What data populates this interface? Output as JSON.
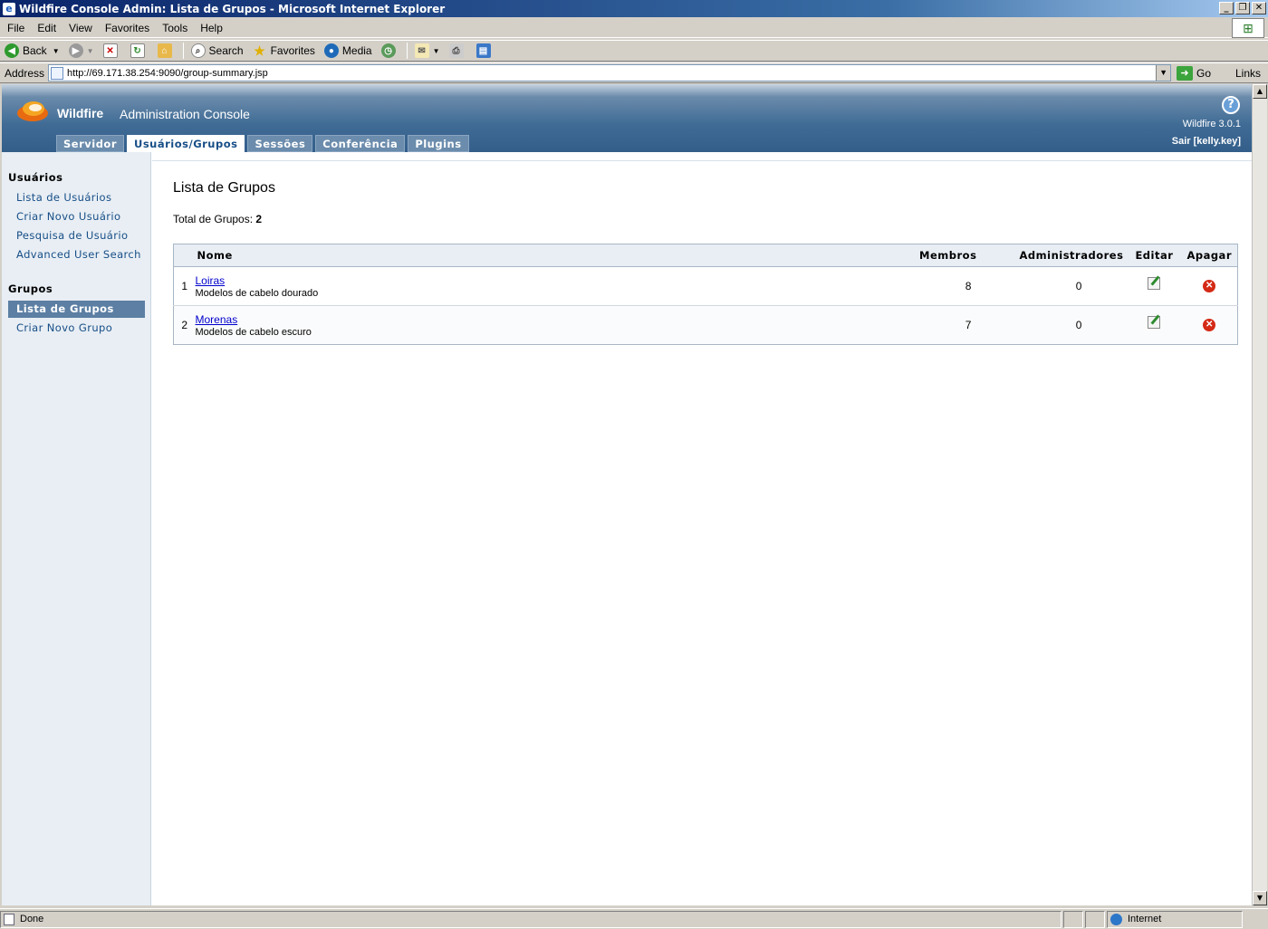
{
  "window": {
    "title": "Wildfire Console Admin: Lista de Grupos - Microsoft Internet Explorer",
    "btn_min": "_",
    "btn_max": "❐",
    "btn_close": "✕"
  },
  "menu": [
    "File",
    "Edit",
    "View",
    "Favorites",
    "Tools",
    "Help"
  ],
  "toolbar": {
    "back": "Back",
    "search": "Search",
    "favorites": "Favorites",
    "media": "Media"
  },
  "address": {
    "label": "Address",
    "url": "http://69.171.38.254:9090/group-summary.jsp",
    "go": "Go",
    "links": "Links"
  },
  "header": {
    "brand": "Wildfire",
    "console": "Administration Console",
    "help": "?",
    "version": "Wildfire 3.0.1",
    "logout": "Sair [kelly.key]"
  },
  "tabs": [
    {
      "label": "Servidor",
      "active": false
    },
    {
      "label": "Usuários/Grupos",
      "active": true
    },
    {
      "label": "Sessões",
      "active": false
    },
    {
      "label": "Conferência",
      "active": false
    },
    {
      "label": "Plugins",
      "active": false
    }
  ],
  "sidebar": {
    "users_section": "Usuários",
    "users_items": [
      "Lista de Usuários",
      "Criar Novo Usuário",
      "Pesquisa de Usuário",
      "Advanced User Search"
    ],
    "groups_section": "Grupos",
    "groups_items": [
      "Lista de Grupos",
      "Criar Novo Grupo"
    ]
  },
  "main": {
    "title": "Lista de Grupos",
    "total_label": "Total de Grupos:",
    "total_value": "2",
    "columns": {
      "name": "Nome",
      "members": "Membros",
      "admins": "Administradores",
      "edit": "Editar",
      "delete": "Apagar"
    },
    "rows": [
      {
        "num": "1",
        "name": "Loiras",
        "desc": "Modelos de cabelo dourado",
        "members": "8",
        "admins": "0"
      },
      {
        "num": "2",
        "name": "Morenas",
        "desc": "Modelos de cabelo escuro",
        "members": "7",
        "admins": "0"
      }
    ]
  },
  "status": {
    "text": "Done",
    "zone": "Internet"
  },
  "colors": {
    "header_blue": "#335e8a",
    "tab_inactive": "#6b8cac",
    "sidebar_bg": "#e8eef4",
    "sidebar_active": "#5c7fa3",
    "link": "#0000cc"
  }
}
